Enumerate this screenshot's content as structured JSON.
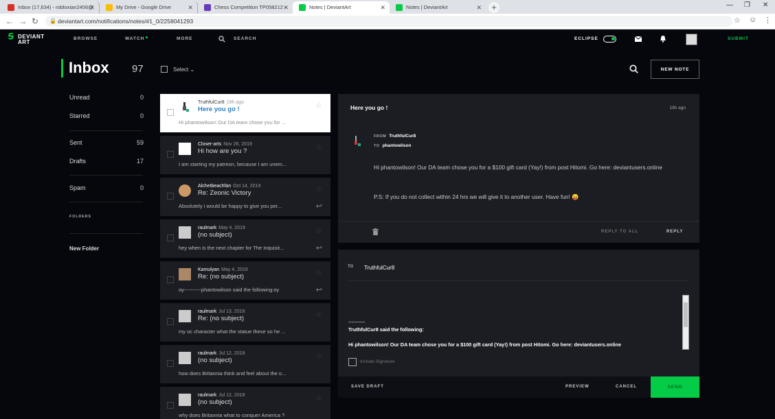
{
  "browser": {
    "tabs": [
      {
        "title": "Inbox (17,634) - robloxian2456@",
        "favicon_color": "#d93025"
      },
      {
        "title": "My Drive - Google Drive",
        "favicon_color": "#fbbc04"
      },
      {
        "title": "Chess Competition TP058212 - ",
        "favicon_color": "#673ab7"
      },
      {
        "title": "Notes | DeviantArt",
        "favicon_color": "#05cc47"
      },
      {
        "title": "Notes | DeviantArt",
        "favicon_color": "#05cc47"
      }
    ],
    "url": "deviantart.com/notifications/notes/#1_0/2258041293"
  },
  "nav": {
    "logo_line1": "DEVIANT",
    "logo_line2": "ART",
    "browse": "BROWSE",
    "watch": "WATCH",
    "more": "MORE",
    "search": "SEARCH",
    "eclipse": "ECLIPSE",
    "submit": "SUBMIT"
  },
  "inbox": {
    "title": "Inbox",
    "count": "97",
    "select_label": "Select",
    "new_note": "NEW NOTE"
  },
  "sidebar": {
    "items": [
      {
        "label": "Unread",
        "count": "0"
      },
      {
        "label": "Starred",
        "count": "0"
      },
      {
        "label": "Sent",
        "count": "59"
      },
      {
        "label": "Drafts",
        "count": "17"
      },
      {
        "label": "Spam",
        "count": "0"
      }
    ],
    "folders_heading": "FOLDERS",
    "new_folder": "New Folder"
  },
  "messages": [
    {
      "sender": "TruthfulCur8",
      "time": "19h ago",
      "subject": "Here you go !",
      "preview": "Hi phantowilson! Our DA team chose you for ..."
    },
    {
      "sender": "Closer-arts",
      "time": "Nov 26, 2019",
      "subject": "Hi how are you ?",
      "preview": "I am starting my patreon, because I am unem..."
    },
    {
      "sender": "Alchetbeachfan",
      "time": "Oct 14, 2019",
      "subject": "Re: Zeonic Victory",
      "preview": "Absolutely i would be happy to give you per..."
    },
    {
      "sender": "raulmark",
      "time": "May 4, 2019",
      "subject": "(no subject)",
      "preview": "hey when is the next chapter for The Inquisit..."
    },
    {
      "sender": "Kamulyan",
      "time": "May 4, 2019",
      "subject": "Re: (no subject)",
      "preview": "oy----------phantowilson said the following:oy"
    },
    {
      "sender": "raulmark",
      "time": "Jul 13, 2018",
      "subject": "Re: (no subject)",
      "preview": "my oc character what the statue these so he ..."
    },
    {
      "sender": "raulmark",
      "time": "Jul 12, 2018",
      "subject": "(no subject)",
      "preview": "how does Britannia think and feel about the o..."
    },
    {
      "sender": "raulmark",
      "time": "Jul 12, 2018",
      "subject": "(no subject)",
      "preview": "why does Britannia what to conquer America ?"
    }
  ],
  "reader": {
    "subject": "Here you go !",
    "time": "19h ago",
    "from_label": "FROM",
    "from": "TruthfulCur8",
    "to_label": "TO",
    "to": "phantowilson",
    "body1": "Hi phantowilson! Our DA team chose you for a $100 gift card (Yay!) from post Hitomi. Go here: deviantusers.online",
    "body2": "P.S: If you do not collect within 24 hrs we will give it to another user. Have fun! 😛",
    "reply_all": "REPLY TO ALL",
    "reply": "REPLY"
  },
  "composer": {
    "to_label": "TO",
    "to": "TruthfulCur8",
    "quote_sep": "----------",
    "quote_header": "TruthfulCur8 said the following:",
    "quote_body": "Hi phantowilson! Our DA team chose you for a $100 gift card (Yay!) from post Hitomi. Go here: deviantusers.online",
    "include_signature": "Include Signature",
    "save_draft": "SAVE DRAFT",
    "preview": "PREVIEW",
    "cancel": "CANCEL",
    "send": "SEND"
  },
  "colors": {
    "accent": "#05cc47",
    "bg": "#06070d",
    "panel": "#1b1d23"
  }
}
